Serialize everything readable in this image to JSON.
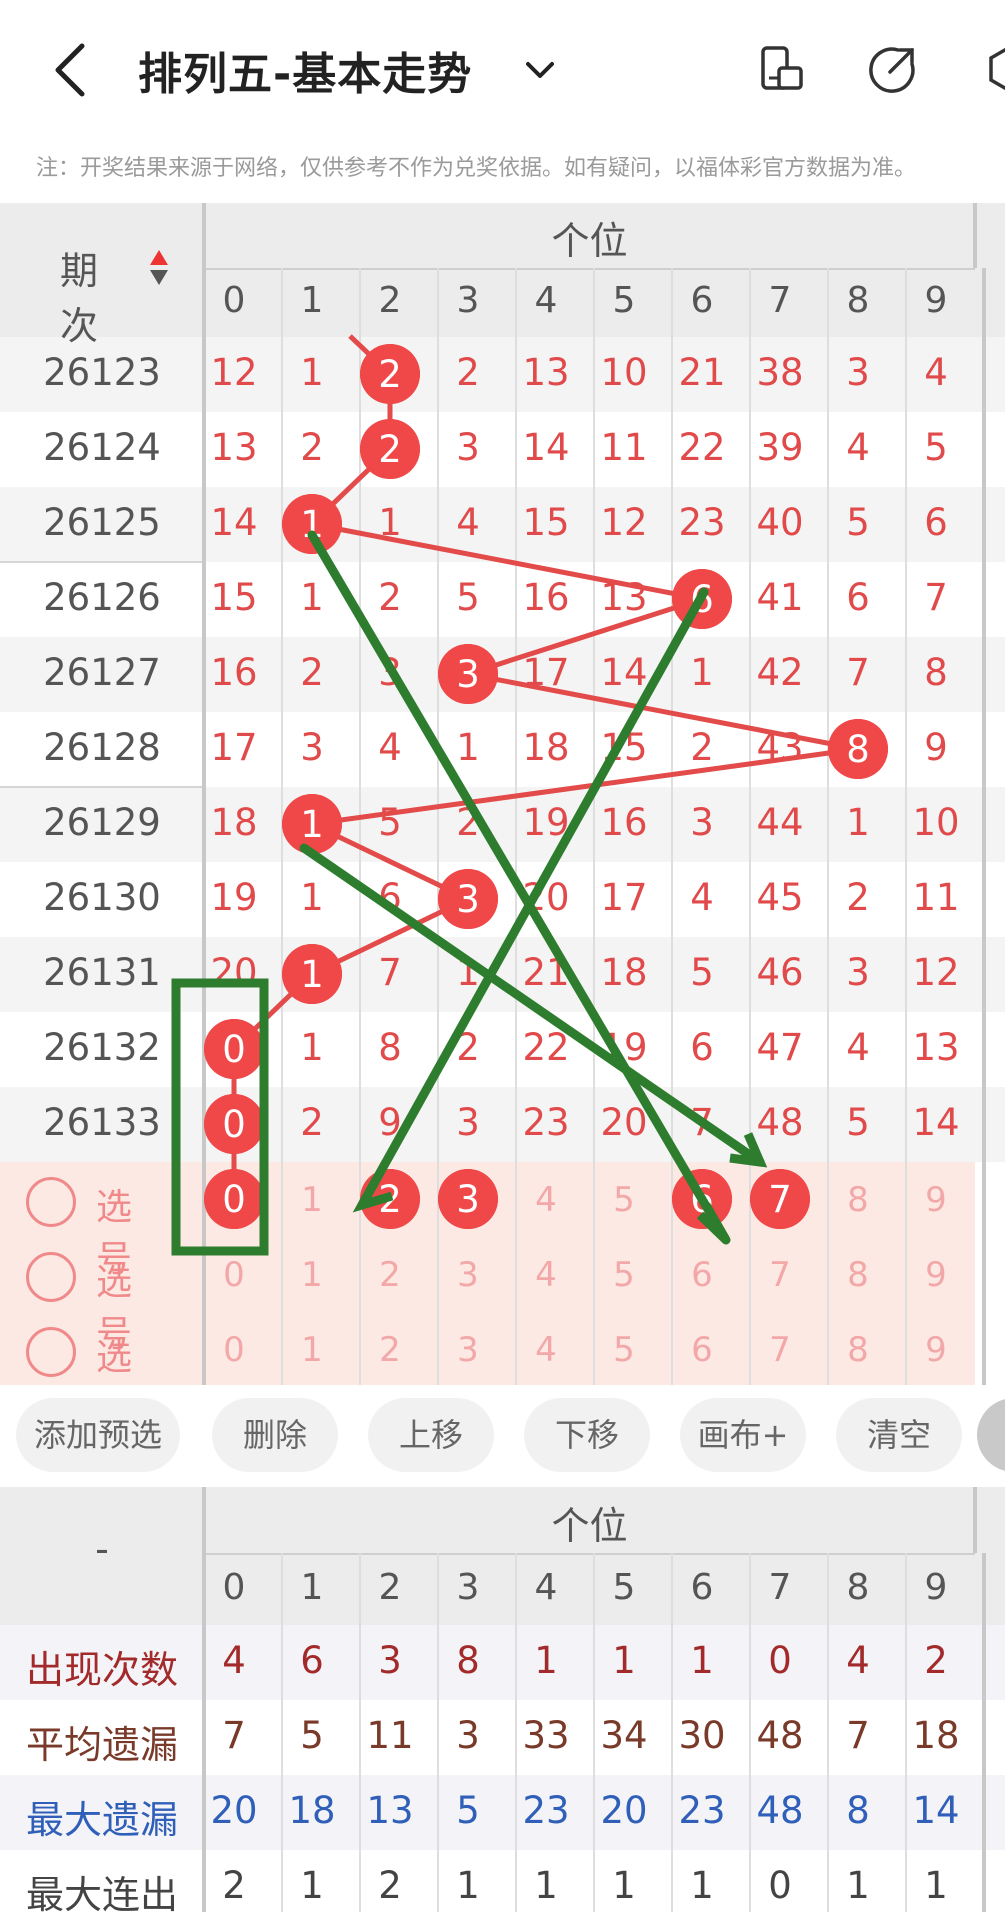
{
  "header": {
    "title": "排列五-基本走势",
    "notice": "注：开奖结果来源于网络，仅供参考不作为兑奖依据。如有疑问，以福体彩官方数据为准。"
  },
  "table": {
    "period_header": "期次",
    "position_header": "个位",
    "digit_headers": [
      "0",
      "1",
      "2",
      "3",
      "4",
      "5",
      "6",
      "7",
      "8",
      "9"
    ],
    "rows": [
      {
        "period": "26123",
        "winner": 2,
        "cells": [
          "12",
          "1",
          "2",
          "2",
          "13",
          "10",
          "21",
          "38",
          "3",
          "4"
        ]
      },
      {
        "period": "26124",
        "winner": 2,
        "cells": [
          "13",
          "2",
          "2",
          "3",
          "14",
          "11",
          "22",
          "39",
          "4",
          "5"
        ]
      },
      {
        "period": "26125",
        "winner": 1,
        "cells": [
          "14",
          "1",
          "1",
          "4",
          "15",
          "12",
          "23",
          "40",
          "5",
          "6"
        ]
      },
      {
        "period": "26126",
        "winner": 6,
        "cells": [
          "15",
          "1",
          "2",
          "5",
          "16",
          "13",
          "6",
          "41",
          "6",
          "7"
        ]
      },
      {
        "period": "26127",
        "winner": 3,
        "cells": [
          "16",
          "2",
          "3",
          "3",
          "17",
          "14",
          "1",
          "42",
          "7",
          "8"
        ]
      },
      {
        "period": "26128",
        "winner": 8,
        "cells": [
          "17",
          "3",
          "4",
          "1",
          "18",
          "15",
          "2",
          "43",
          "8",
          "9"
        ]
      },
      {
        "period": "26129",
        "winner": 1,
        "cells": [
          "18",
          "1",
          "5",
          "2",
          "19",
          "16",
          "3",
          "44",
          "1",
          "10"
        ]
      },
      {
        "period": "26130",
        "winner": 3,
        "cells": [
          "19",
          "1",
          "6",
          "3",
          "20",
          "17",
          "4",
          "45",
          "2",
          "11"
        ]
      },
      {
        "period": "26131",
        "winner": 1,
        "cells": [
          "20",
          "1",
          "7",
          "1",
          "21",
          "18",
          "5",
          "46",
          "3",
          "12"
        ]
      },
      {
        "period": "26132",
        "winner": 0,
        "cells": [
          "0",
          "1",
          "8",
          "2",
          "22",
          "19",
          "6",
          "47",
          "4",
          "13"
        ]
      },
      {
        "period": "26133",
        "winner": 0,
        "cells": [
          "0",
          "2",
          "9",
          "3",
          "23",
          "20",
          "7",
          "48",
          "5",
          "14"
        ]
      }
    ],
    "pick_rows": [
      {
        "label": "选号",
        "selected": [
          0,
          2,
          3,
          6,
          7
        ],
        "digits": [
          "0",
          "1",
          "2",
          "3",
          "4",
          "5",
          "6",
          "7",
          "8",
          "9"
        ]
      },
      {
        "label": "选号",
        "selected": [],
        "digits": [
          "0",
          "1",
          "2",
          "3",
          "4",
          "5",
          "6",
          "7",
          "8",
          "9"
        ]
      },
      {
        "label": "选号",
        "selected": [],
        "digits": [
          "0",
          "1",
          "2",
          "3",
          "4",
          "5",
          "6",
          "7",
          "8",
          "9"
        ]
      }
    ]
  },
  "buttons": [
    "添加预选",
    "删除",
    "上移",
    "下移",
    "画布+",
    "清空"
  ],
  "stats": {
    "corner": "-",
    "position_header": "个位",
    "digit_headers": [
      "0",
      "1",
      "2",
      "3",
      "4",
      "5",
      "6",
      "7",
      "8",
      "9"
    ],
    "rows": [
      {
        "label": "出现次数",
        "color": "#a32a2a",
        "values": [
          "4",
          "6",
          "3",
          "8",
          "1",
          "1",
          "1",
          "0",
          "4",
          "2"
        ]
      },
      {
        "label": "平均遗漏",
        "color": "#7a3a2a",
        "values": [
          "7",
          "5",
          "11",
          "3",
          "33",
          "34",
          "30",
          "48",
          "7",
          "18"
        ]
      },
      {
        "label": "最大遗漏",
        "color": "#2f5fb8",
        "values": [
          "20",
          "18",
          "13",
          "5",
          "23",
          "20",
          "23",
          "48",
          "8",
          "14"
        ]
      },
      {
        "label": "最大连出",
        "color": "#444444",
        "values": [
          "2",
          "1",
          "2",
          "1",
          "1",
          "1",
          "1",
          "0",
          "1",
          "1"
        ]
      }
    ]
  },
  "colors": {
    "accent": "#f04848",
    "annotation": "#2e7d2e",
    "pick_bg": "#fde9e4"
  }
}
